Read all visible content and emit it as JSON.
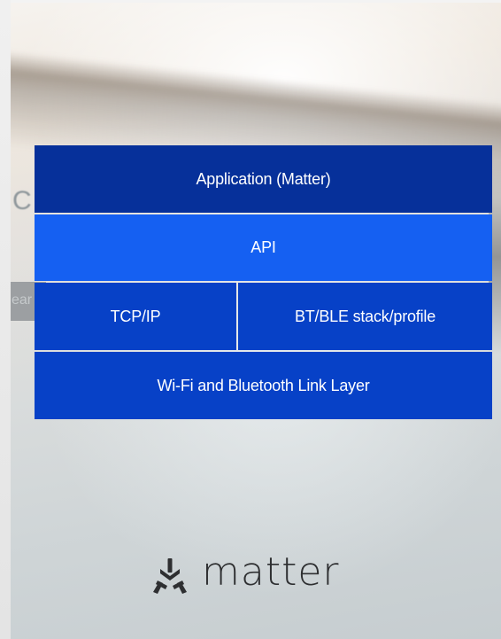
{
  "diagram": {
    "layers": {
      "application": "Application (Matter)",
      "api": "API",
      "tcp_ip": "TCP/IP",
      "bt_ble": "BT/BLE stack/profile",
      "link_layer": "Wi-Fi and Bluetooth Link Layer"
    },
    "colors": {
      "application": "#06309a",
      "api": "#1560f2",
      "transport": "#0741c7",
      "link_layer": "#0741c7",
      "text": "#ffffff"
    }
  },
  "logo": {
    "icon": "matter-logo-icon",
    "wordmark": "matter"
  },
  "background": {
    "ghost_letter": "C",
    "ghost_text": "ear"
  }
}
